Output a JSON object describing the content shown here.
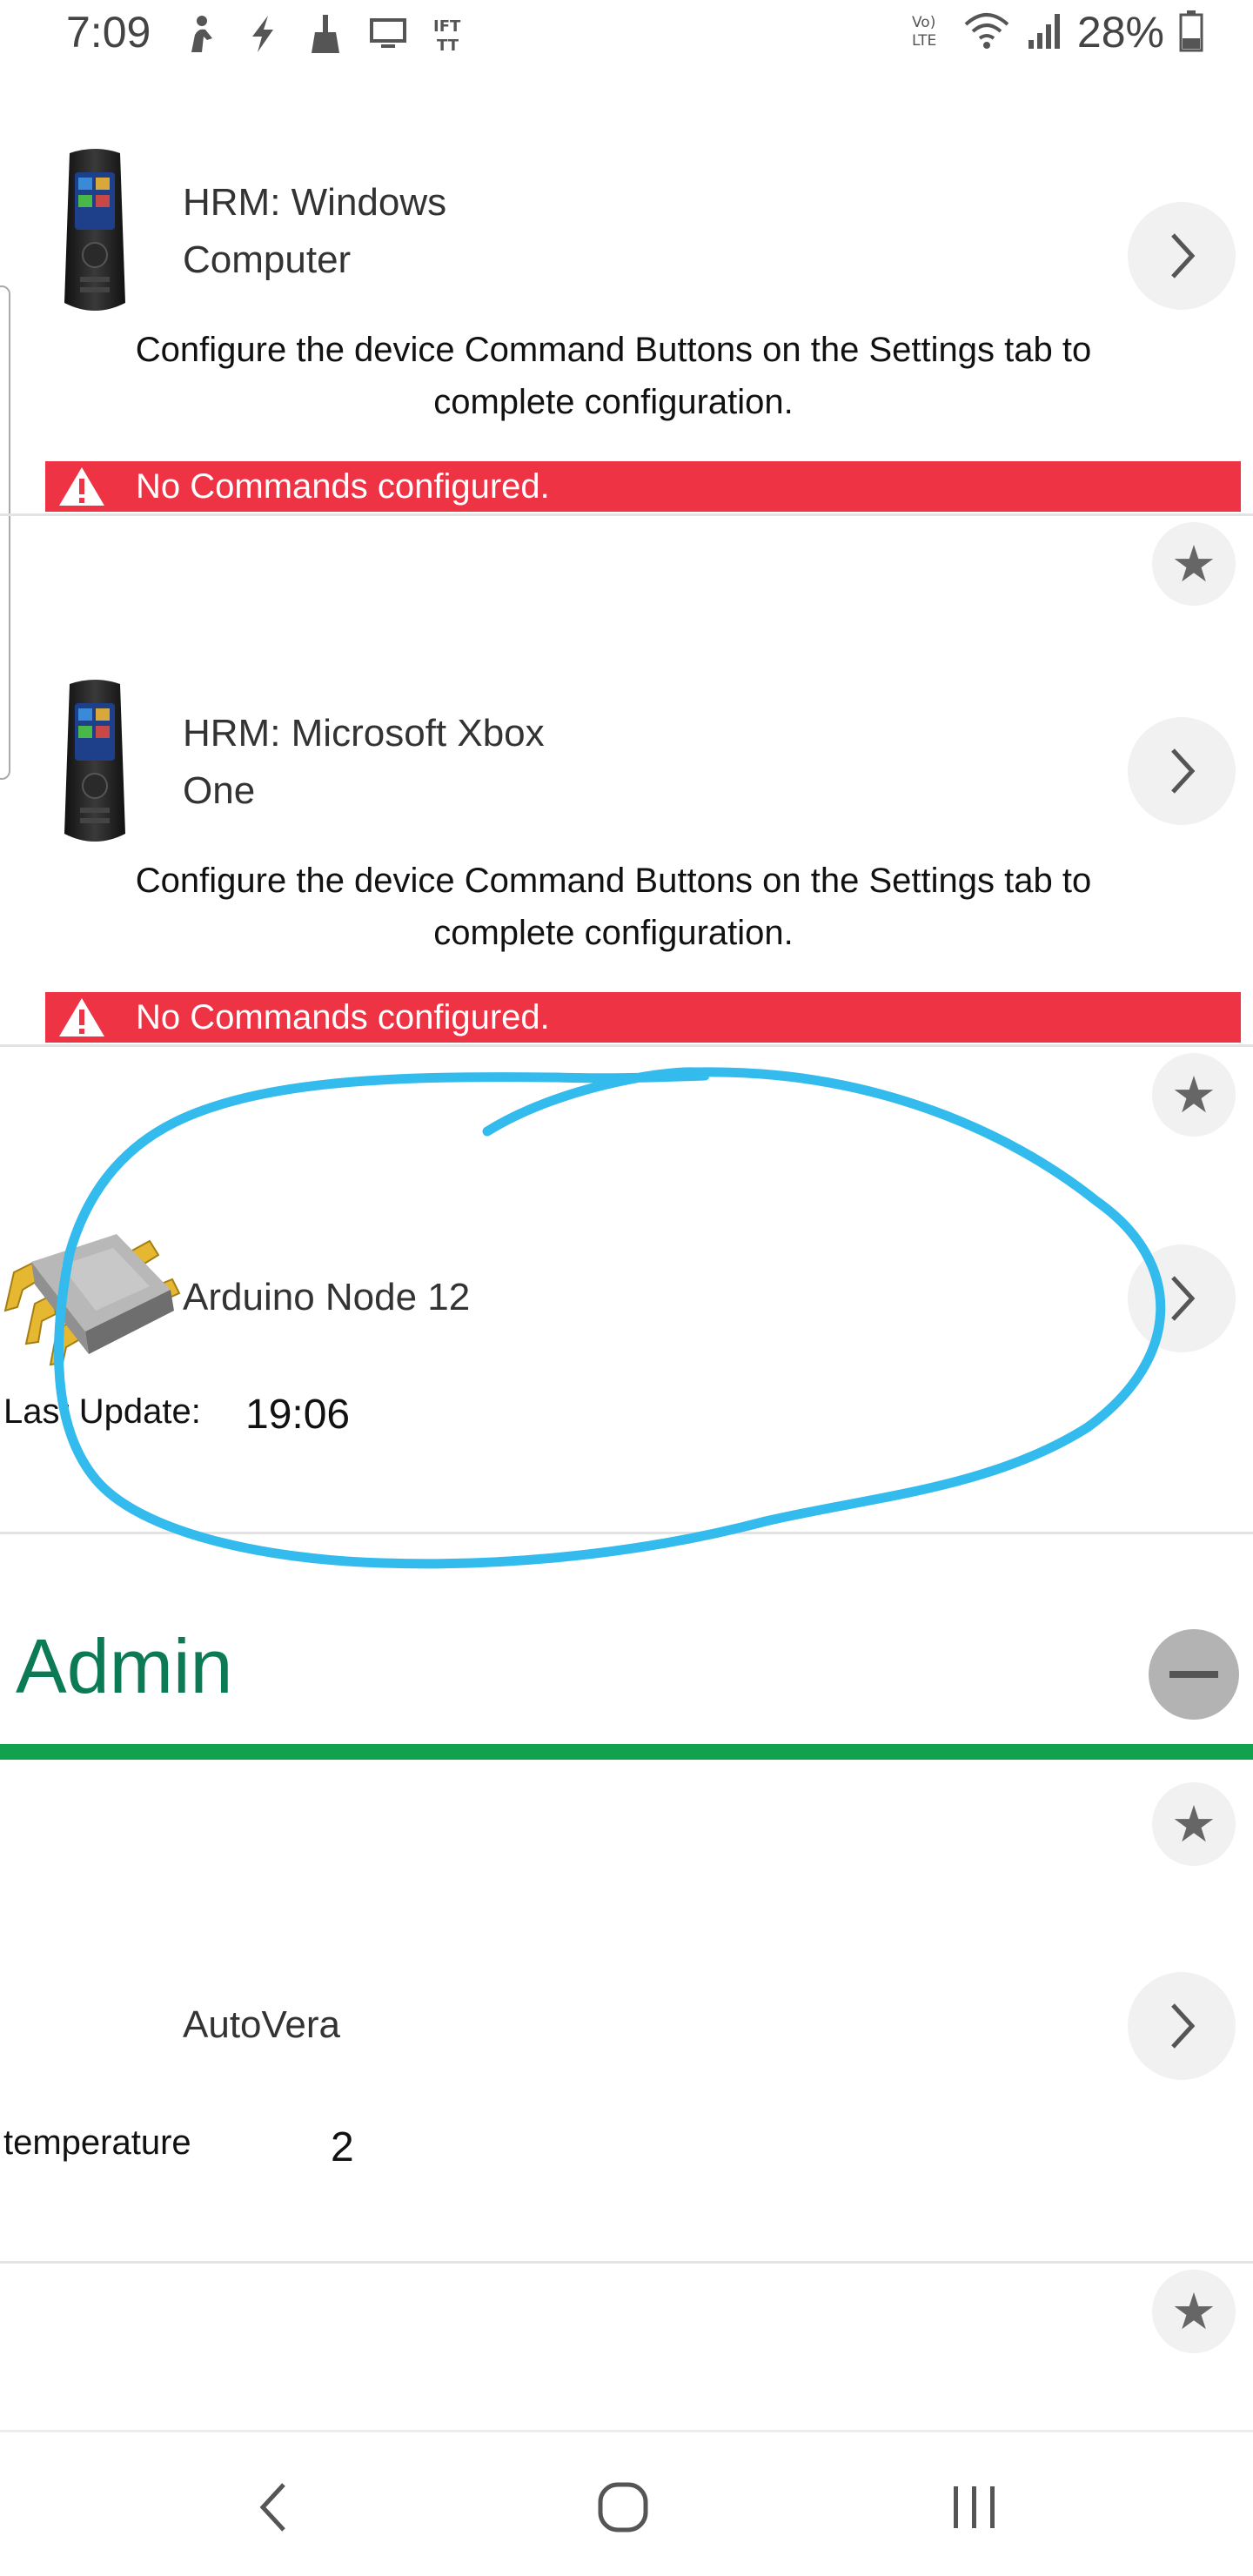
{
  "status_bar": {
    "time": "7:09",
    "battery": "28%",
    "left_icons": [
      "person-icon",
      "lightning-icon",
      "broom-icon",
      "monitor-icon",
      "ifttt-icon"
    ],
    "right_icons": [
      "volte-icon",
      "wifi-icon",
      "signal-icon",
      "battery-icon"
    ],
    "ifttt_label": "IFT\nTT",
    "volte_label": "Vo)\nLTE"
  },
  "devices": [
    {
      "name_line1": "HRM: Windows",
      "name_line2": "Computer",
      "message_line1": "Configure the device Command Buttons on the Settings tab to",
      "message_line2": "complete configuration.",
      "alert": "No Commands configured."
    },
    {
      "name_line1": "HRM: Microsoft Xbox",
      "name_line2": "One",
      "message_line1": "Configure the device Command Buttons on the Settings tab to",
      "message_line2": "complete configuration.",
      "alert": "No Commands configured."
    },
    {
      "name": "Arduino Node 12",
      "label": "Last Update:",
      "value": "19:06"
    }
  ],
  "admin": {
    "title": "Admin",
    "devices": [
      {
        "name": "AutoVera",
        "label": "temperature",
        "value": "2"
      }
    ]
  },
  "colors": {
    "alert_red": "#ee3344",
    "section_green": "#0b7a55",
    "section_bar": "#12a24d",
    "annotation": "#33bbee"
  },
  "nav": [
    "back-icon",
    "home-icon",
    "recents-icon"
  ]
}
